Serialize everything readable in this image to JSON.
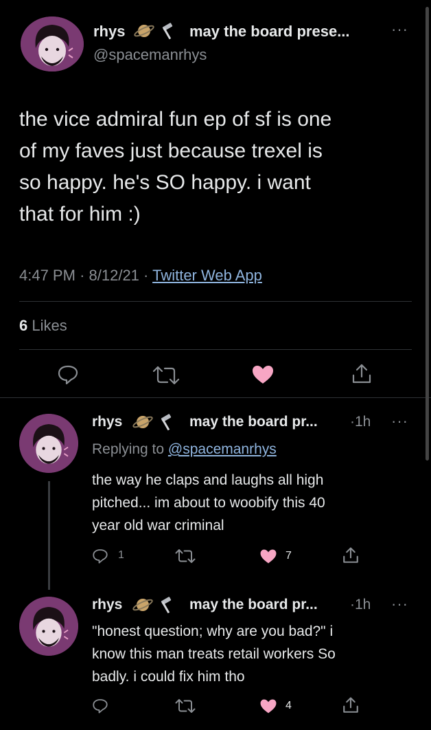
{
  "main_tweet": {
    "display_name": "rhys",
    "display_name_emoji": "🪐🔨",
    "bio_snippet": "may the board prese...",
    "handle": "@spacemanrhys",
    "text_lines": [
      "the vice admiral fun ep of sf is one",
      "of my faves just because trexel is",
      "so happy. he's SO happy. i want",
      "that for him :)"
    ],
    "time": "4:47 PM",
    "date": "8/12/21",
    "source": "Twitter Web App",
    "likes_count": "6",
    "likes_label": "Likes"
  },
  "replies": [
    {
      "display_name": "rhys",
      "bio_snippet": "may the board pr...",
      "age": "1h",
      "replying_label": "Replying to",
      "replying_handle": "@spacemanrhys",
      "text_lines": [
        "the way he claps and laughs all high",
        "pitched... im about to woobify this 40",
        "year old war criminal"
      ],
      "reply_count": "1",
      "like_count": "7"
    },
    {
      "display_name": "rhys",
      "bio_snippet": "may the board pr...",
      "age": "1h",
      "text_lines": [
        "\"honest question; why are you bad?\" i",
        "know this man treats retail workers So",
        "badly. i could fix him tho"
      ],
      "like_count": "4"
    }
  ],
  "colors": {
    "background": "#000000",
    "muted": "#8b8f94",
    "link": "#8fb4de",
    "like_active": "#f7a6c4",
    "avatar": "#7a3a72"
  },
  "separators": {
    "dot": "·"
  },
  "more_glyph": "···"
}
